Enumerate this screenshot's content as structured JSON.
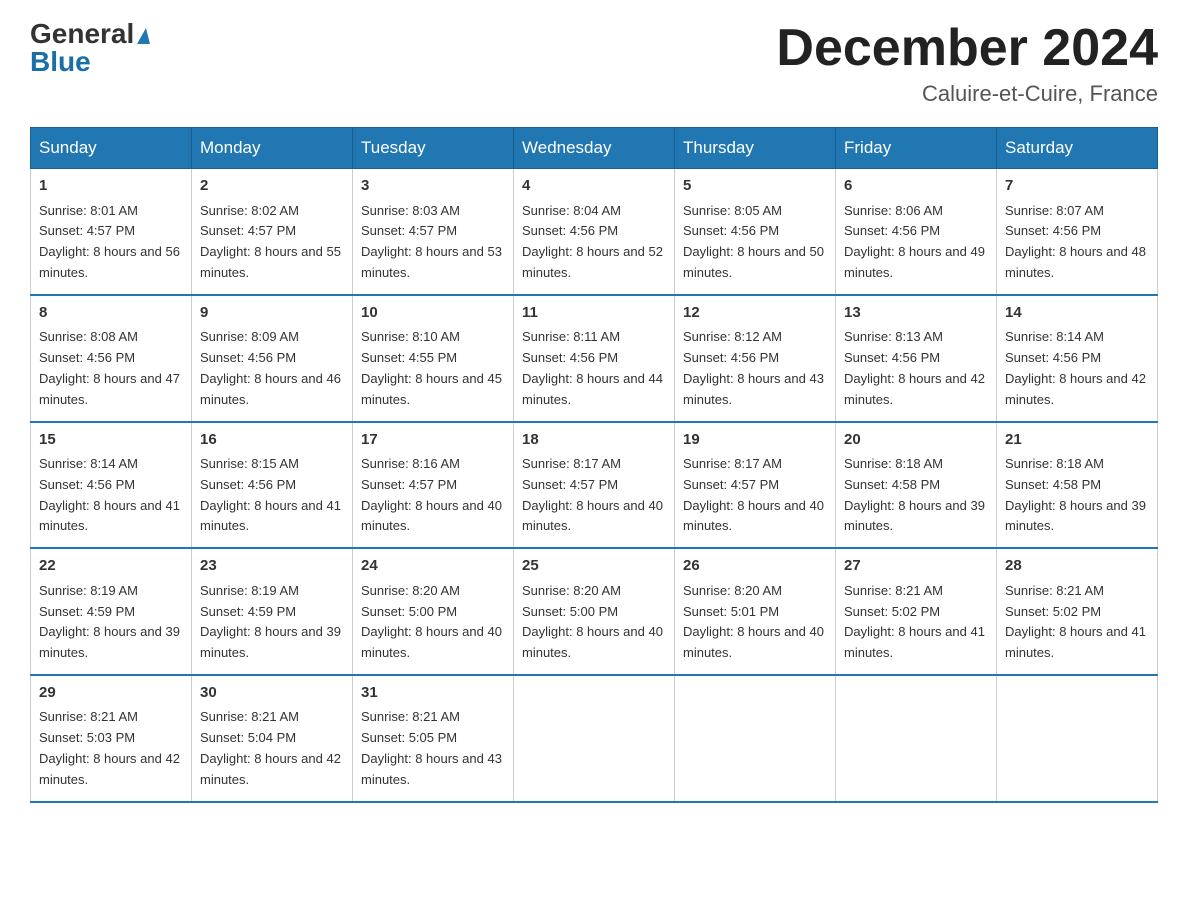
{
  "header": {
    "logo_top": "General",
    "logo_bottom": "Blue",
    "month_title": "December 2024",
    "location": "Caluire-et-Cuire, France"
  },
  "weekdays": [
    "Sunday",
    "Monday",
    "Tuesday",
    "Wednesday",
    "Thursday",
    "Friday",
    "Saturday"
  ],
  "weeks": [
    [
      {
        "day": "1",
        "sunrise": "8:01 AM",
        "sunset": "4:57 PM",
        "daylight": "8 hours and 56 minutes."
      },
      {
        "day": "2",
        "sunrise": "8:02 AM",
        "sunset": "4:57 PM",
        "daylight": "8 hours and 55 minutes."
      },
      {
        "day": "3",
        "sunrise": "8:03 AM",
        "sunset": "4:57 PM",
        "daylight": "8 hours and 53 minutes."
      },
      {
        "day": "4",
        "sunrise": "8:04 AM",
        "sunset": "4:56 PM",
        "daylight": "8 hours and 52 minutes."
      },
      {
        "day": "5",
        "sunrise": "8:05 AM",
        "sunset": "4:56 PM",
        "daylight": "8 hours and 50 minutes."
      },
      {
        "day": "6",
        "sunrise": "8:06 AM",
        "sunset": "4:56 PM",
        "daylight": "8 hours and 49 minutes."
      },
      {
        "day": "7",
        "sunrise": "8:07 AM",
        "sunset": "4:56 PM",
        "daylight": "8 hours and 48 minutes."
      }
    ],
    [
      {
        "day": "8",
        "sunrise": "8:08 AM",
        "sunset": "4:56 PM",
        "daylight": "8 hours and 47 minutes."
      },
      {
        "day": "9",
        "sunrise": "8:09 AM",
        "sunset": "4:56 PM",
        "daylight": "8 hours and 46 minutes."
      },
      {
        "day": "10",
        "sunrise": "8:10 AM",
        "sunset": "4:55 PM",
        "daylight": "8 hours and 45 minutes."
      },
      {
        "day": "11",
        "sunrise": "8:11 AM",
        "sunset": "4:56 PM",
        "daylight": "8 hours and 44 minutes."
      },
      {
        "day": "12",
        "sunrise": "8:12 AM",
        "sunset": "4:56 PM",
        "daylight": "8 hours and 43 minutes."
      },
      {
        "day": "13",
        "sunrise": "8:13 AM",
        "sunset": "4:56 PM",
        "daylight": "8 hours and 42 minutes."
      },
      {
        "day": "14",
        "sunrise": "8:14 AM",
        "sunset": "4:56 PM",
        "daylight": "8 hours and 42 minutes."
      }
    ],
    [
      {
        "day": "15",
        "sunrise": "8:14 AM",
        "sunset": "4:56 PM",
        "daylight": "8 hours and 41 minutes."
      },
      {
        "day": "16",
        "sunrise": "8:15 AM",
        "sunset": "4:56 PM",
        "daylight": "8 hours and 41 minutes."
      },
      {
        "day": "17",
        "sunrise": "8:16 AM",
        "sunset": "4:57 PM",
        "daylight": "8 hours and 40 minutes."
      },
      {
        "day": "18",
        "sunrise": "8:17 AM",
        "sunset": "4:57 PM",
        "daylight": "8 hours and 40 minutes."
      },
      {
        "day": "19",
        "sunrise": "8:17 AM",
        "sunset": "4:57 PM",
        "daylight": "8 hours and 40 minutes."
      },
      {
        "day": "20",
        "sunrise": "8:18 AM",
        "sunset": "4:58 PM",
        "daylight": "8 hours and 39 minutes."
      },
      {
        "day": "21",
        "sunrise": "8:18 AM",
        "sunset": "4:58 PM",
        "daylight": "8 hours and 39 minutes."
      }
    ],
    [
      {
        "day": "22",
        "sunrise": "8:19 AM",
        "sunset": "4:59 PM",
        "daylight": "8 hours and 39 minutes."
      },
      {
        "day": "23",
        "sunrise": "8:19 AM",
        "sunset": "4:59 PM",
        "daylight": "8 hours and 39 minutes."
      },
      {
        "day": "24",
        "sunrise": "8:20 AM",
        "sunset": "5:00 PM",
        "daylight": "8 hours and 40 minutes."
      },
      {
        "day": "25",
        "sunrise": "8:20 AM",
        "sunset": "5:00 PM",
        "daylight": "8 hours and 40 minutes."
      },
      {
        "day": "26",
        "sunrise": "8:20 AM",
        "sunset": "5:01 PM",
        "daylight": "8 hours and 40 minutes."
      },
      {
        "day": "27",
        "sunrise": "8:21 AM",
        "sunset": "5:02 PM",
        "daylight": "8 hours and 41 minutes."
      },
      {
        "day": "28",
        "sunrise": "8:21 AM",
        "sunset": "5:02 PM",
        "daylight": "8 hours and 41 minutes."
      }
    ],
    [
      {
        "day": "29",
        "sunrise": "8:21 AM",
        "sunset": "5:03 PM",
        "daylight": "8 hours and 42 minutes."
      },
      {
        "day": "30",
        "sunrise": "8:21 AM",
        "sunset": "5:04 PM",
        "daylight": "8 hours and 42 minutes."
      },
      {
        "day": "31",
        "sunrise": "8:21 AM",
        "sunset": "5:05 PM",
        "daylight": "8 hours and 43 minutes."
      },
      null,
      null,
      null,
      null
    ]
  ]
}
